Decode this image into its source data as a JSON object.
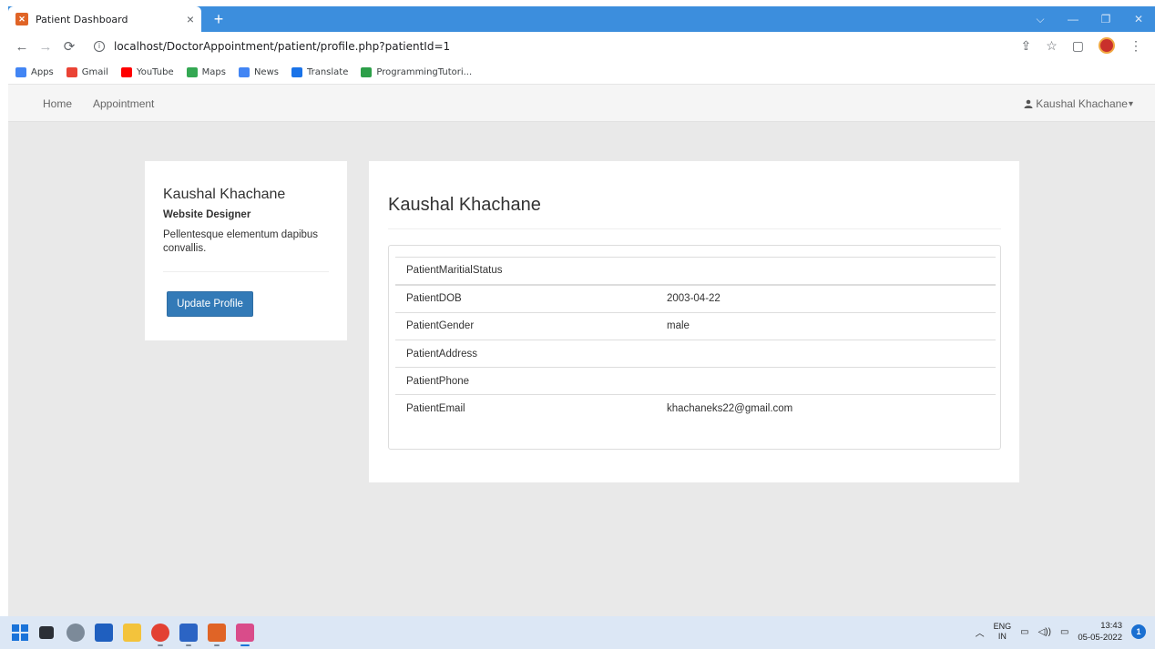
{
  "browser": {
    "tab_title": "Patient Dashboard",
    "tab_close": "×",
    "new_tab": "+",
    "window_controls": [
      "⌵",
      "—",
      "❐",
      "✕"
    ],
    "url": "localhost/DoctorAppointment/patient/profile.php?patientId=1",
    "bookmarks": [
      {
        "label": "Apps",
        "color": "#4285f4"
      },
      {
        "label": "Gmail",
        "color": "#ea4335"
      },
      {
        "label": "YouTube",
        "color": "#ff0000"
      },
      {
        "label": "Maps",
        "color": "#34a853"
      },
      {
        "label": "News",
        "color": "#4285f4"
      },
      {
        "label": "Translate",
        "color": "#1a73e8"
      },
      {
        "label": "ProgrammingTutori...",
        "color": "#2d9f49"
      }
    ]
  },
  "navbar": {
    "home": "Home",
    "appointment": "Appointment",
    "user": "Kaushal Khachane",
    "caret": "▾"
  },
  "profile": {
    "name": "Kaushal Khachane",
    "role": "Website Designer",
    "description": "Pellentesque elementum dapibus convallis.",
    "update_button": "Update Profile"
  },
  "details": {
    "title": "Kaushal Khachane",
    "rows": [
      {
        "key": "PatientMaritialStatus",
        "value": ""
      },
      {
        "key": "PatientDOB",
        "value": "2003-04-22"
      },
      {
        "key": "PatientGender",
        "value": "male"
      },
      {
        "key": "PatientAddress",
        "value": ""
      },
      {
        "key": "PatientPhone",
        "value": ""
      },
      {
        "key": "PatientEmail",
        "value": "khachaneks22@gmail.com"
      }
    ]
  },
  "taskbar": {
    "lang_top": "ENG",
    "lang_bottom": "IN",
    "time": "13:43",
    "date": "05-05-2022",
    "notifications": "1"
  },
  "colors": {
    "accent": "#337ab7",
    "tabstrip": "#3c8edd",
    "page_bg": "#e9e9e9"
  }
}
